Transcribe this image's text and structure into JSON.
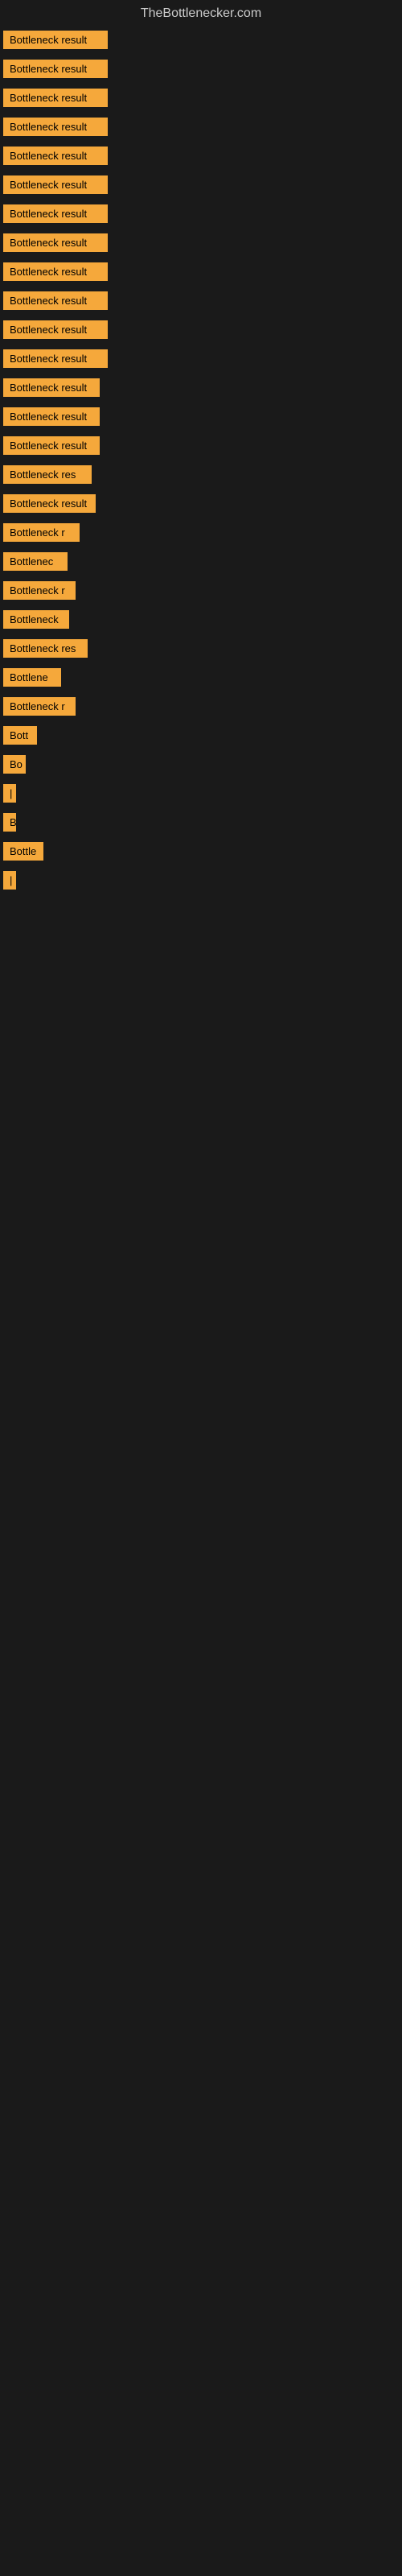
{
  "site": {
    "title": "TheBottlenecker.com"
  },
  "items": [
    {
      "label": "Bottleneck result",
      "width": 130
    },
    {
      "label": "Bottleneck result",
      "width": 130
    },
    {
      "label": "Bottleneck result",
      "width": 130
    },
    {
      "label": "Bottleneck result",
      "width": 130
    },
    {
      "label": "Bottleneck result",
      "width": 130
    },
    {
      "label": "Bottleneck result",
      "width": 130
    },
    {
      "label": "Bottleneck result",
      "width": 130
    },
    {
      "label": "Bottleneck result",
      "width": 130
    },
    {
      "label": "Bottleneck result",
      "width": 130
    },
    {
      "label": "Bottleneck result",
      "width": 130
    },
    {
      "label": "Bottleneck result",
      "width": 130
    },
    {
      "label": "Bottleneck result",
      "width": 130
    },
    {
      "label": "Bottleneck result",
      "width": 120
    },
    {
      "label": "Bottleneck result",
      "width": 120
    },
    {
      "label": "Bottleneck result",
      "width": 120
    },
    {
      "label": "Bottleneck res",
      "width": 110
    },
    {
      "label": "Bottleneck result",
      "width": 115
    },
    {
      "label": "Bottleneck r",
      "width": 95
    },
    {
      "label": "Bottlenec",
      "width": 80
    },
    {
      "label": "Bottleneck r",
      "width": 90
    },
    {
      "label": "Bottleneck",
      "width": 82
    },
    {
      "label": "Bottleneck res",
      "width": 105
    },
    {
      "label": "Bottlene",
      "width": 72
    },
    {
      "label": "Bottleneck r",
      "width": 90
    },
    {
      "label": "Bott",
      "width": 42
    },
    {
      "label": "Bo",
      "width": 28
    },
    {
      "label": "|",
      "width": 8
    },
    {
      "label": "B",
      "width": 14
    },
    {
      "label": "Bottle",
      "width": 50
    },
    {
      "label": "|",
      "width": 8
    }
  ]
}
